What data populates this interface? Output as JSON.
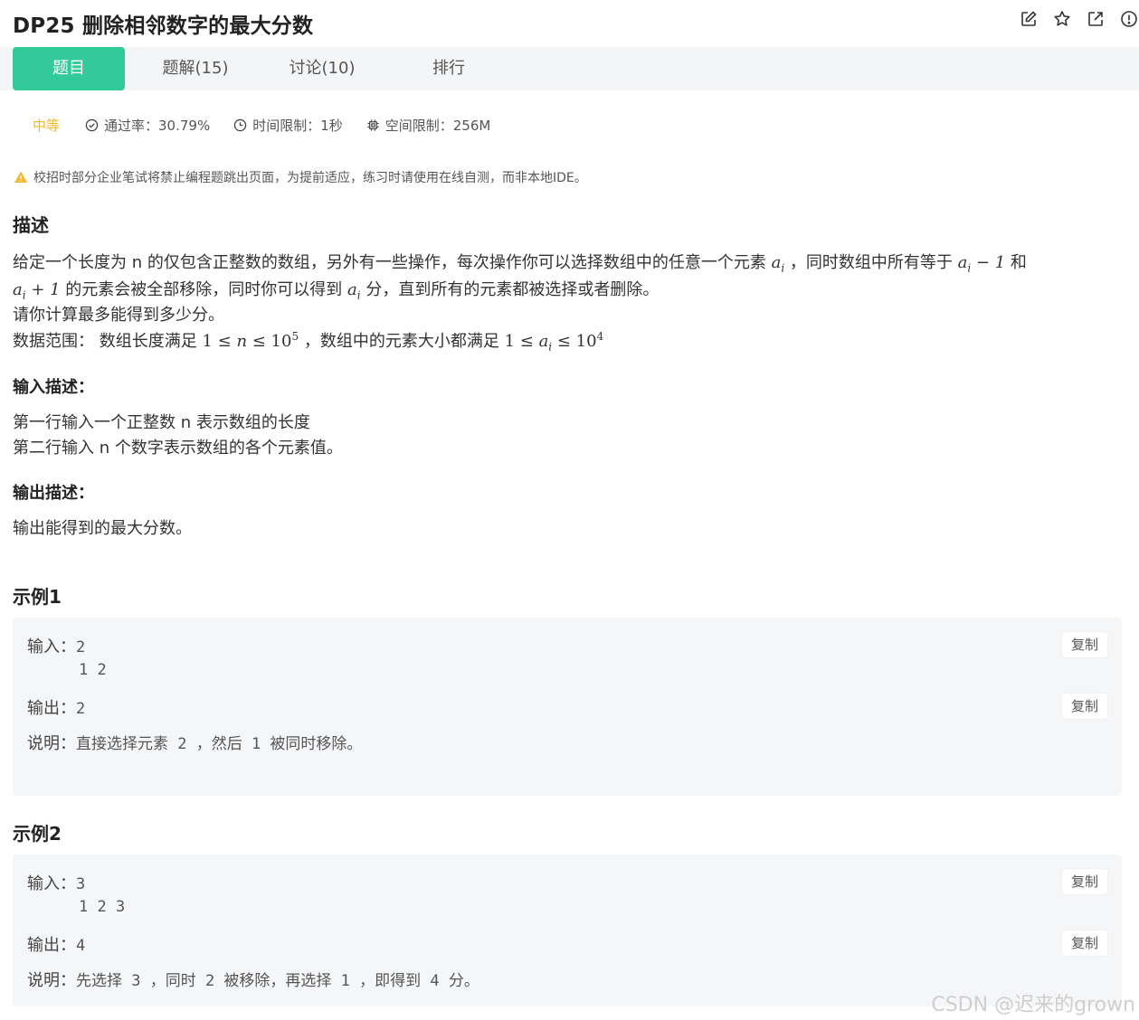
{
  "header": {
    "title": "DP25  删除相邻数字的最大分数",
    "icons": [
      "edit-icon",
      "star-icon",
      "external-link-icon",
      "info-icon"
    ]
  },
  "tabs": [
    {
      "label": "题目",
      "active": true
    },
    {
      "label": "题解(15)",
      "active": false
    },
    {
      "label": "讨论(10)",
      "active": false
    },
    {
      "label": "排行",
      "active": false
    }
  ],
  "meta": {
    "difficulty": "中等",
    "pass_rate": "通过率：30.79%",
    "time_limit": "时间限制：1秒",
    "memory_limit": "空间限制：256M"
  },
  "notice": "校招时部分企业笔试将禁止编程题跳出页面，为提前适应，练习时请使用在线自测，而非本地IDE。",
  "description": {
    "heading": "描述",
    "line1_a": "给定一个长度为 n 的仅包含正整数的数组，另外有一些操作，每次操作你可以选择数组中的任意一个元素 ",
    "line1_b": "，同时数组中所有等于 ",
    "line1_c": " 和",
    "line2_a": " 的元素会被全部移除，同时你可以得到 ",
    "line2_b": " 分，直到所有的元素都被选择或者删除。",
    "line3": "请你计算最多能得到多少分。",
    "line4_a": "数据范围： 数组长度满足 ",
    "line4_b": "，数组中的元素大小都满足 "
  },
  "input_desc": {
    "heading": "输入描述：",
    "lines": [
      "第一行输入一个正整数 n 表示数组的长度",
      "第二行输入 n 个数字表示数组的各个元素值。"
    ]
  },
  "output_desc": {
    "heading": "输出描述：",
    "lines": [
      "输出能得到的最大分数。"
    ]
  },
  "examples": [
    {
      "heading": "示例1",
      "input_label": "输入：",
      "input_lines": [
        "2",
        "1 2"
      ],
      "output_label": "输出：",
      "output": "2",
      "explain_label": "说明：",
      "explain": "直接选择元素 2 ，然后 1 被同时移除。",
      "copy_label": "复制"
    },
    {
      "heading": "示例2",
      "input_label": "输入：",
      "input_lines": [
        "3",
        "1 2 3"
      ],
      "output_label": "输出：",
      "output": "4",
      "explain_label": "说明：",
      "explain": "先选择 3 ，同时 2 被移除，再选择 1 ，即得到 4 分。",
      "copy_label": "复制"
    }
  ],
  "watermark": "CSDN @迟来的grown",
  "colors": {
    "accent": "#32ca99",
    "difficulty": "#f1b81a",
    "warning": "#f5b82e"
  }
}
